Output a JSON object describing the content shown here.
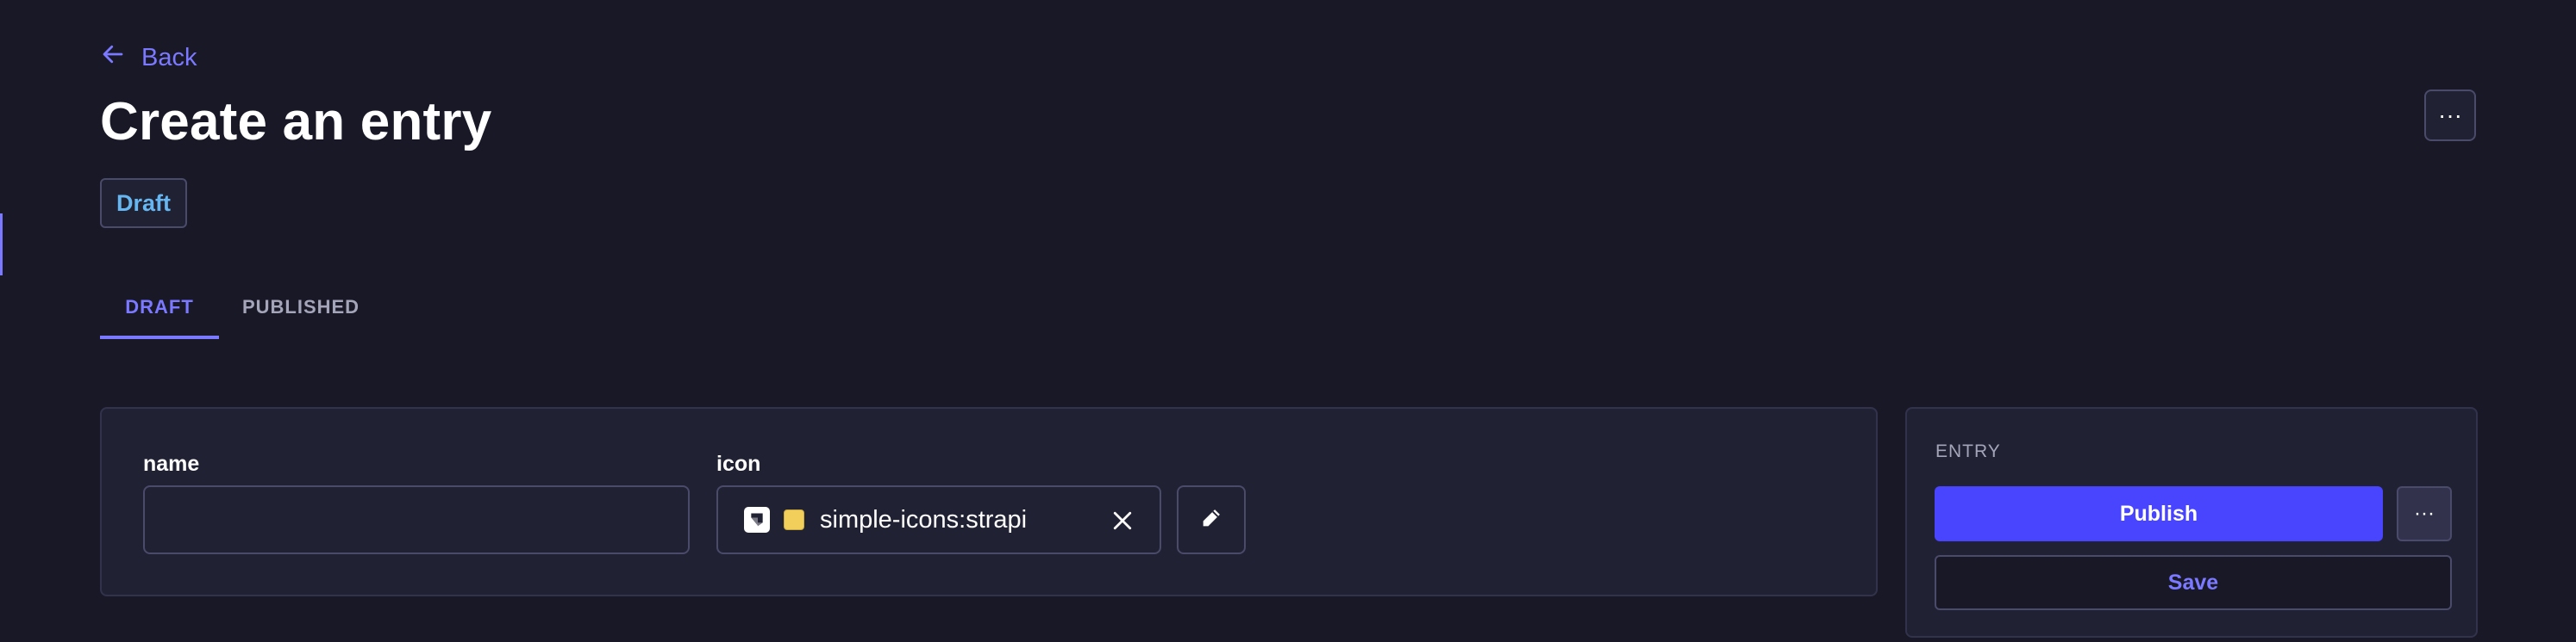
{
  "header": {
    "back_label": "Back",
    "title": "Create an entry",
    "more_label": "···",
    "status": "Draft"
  },
  "tabs": [
    {
      "label": "DRAFT",
      "active": true
    },
    {
      "label": "PUBLISHED",
      "active": false
    }
  ],
  "form": {
    "name": {
      "label": "name",
      "value": ""
    },
    "icon": {
      "label": "icon",
      "value": "simple-icons:strapi",
      "swatch_color": "#f2cf5b"
    }
  },
  "entry_panel": {
    "title": "ENTRY",
    "publish_label": "Publish",
    "more_label": "···",
    "save_label": "Save"
  },
  "colors": {
    "background": "#181826",
    "surface": "#212134",
    "accent": "#7b79ff",
    "primary": "#4945ff",
    "status_text": "#66b7f1"
  },
  "icons": {
    "back": "arrow-left-icon",
    "brand": "strapi-icon",
    "clear": "close-icon",
    "edit": "pencil-icon"
  }
}
